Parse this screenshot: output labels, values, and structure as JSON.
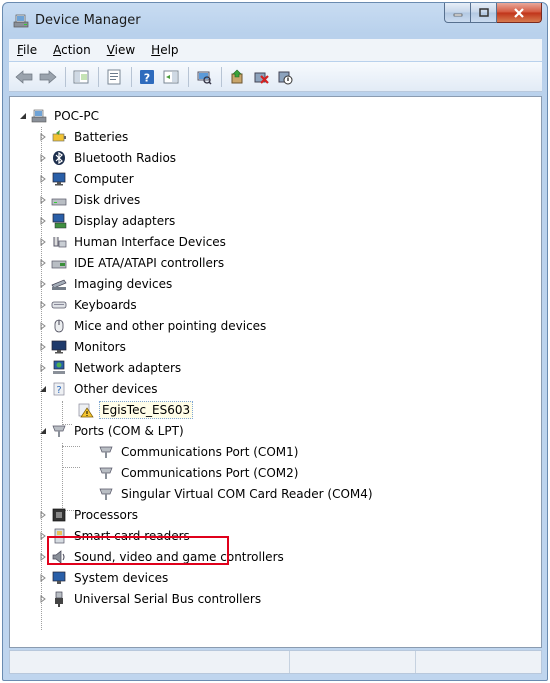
{
  "window": {
    "title": "Device Manager"
  },
  "menu": {
    "file": "F",
    "file_rest": "ile",
    "action": "A",
    "action_rest": "ction",
    "view": "V",
    "view_rest": "iew",
    "help": "H",
    "help_rest": "elp"
  },
  "toolbar": {
    "icons": [
      "back-arrow-icon",
      "forward-arrow-icon",
      "properties-icon",
      "show-hide-console-tree-icon",
      "help-icon",
      "action-pane-icon",
      "scan-hardware-icon",
      "update-driver-icon",
      "uninstall-icon",
      "disable-icon"
    ]
  },
  "tree": {
    "root": "POC-PC",
    "batteries": "Batteries",
    "bluetooth": "Bluetooth Radios",
    "computer": "Computer",
    "disk": "Disk drives",
    "display": "Display adapters",
    "hid": "Human Interface Devices",
    "ide": "IDE ATA/ATAPI controllers",
    "imaging": "Imaging devices",
    "keyboards": "Keyboards",
    "mice": "Mice and other pointing devices",
    "monitors": "Monitors",
    "network": "Network adapters",
    "other": "Other devices",
    "egistec": "EgisTec_ES603",
    "ports": "Ports (COM & LPT)",
    "com1": "Communications Port (COM1)",
    "com2": "Communications Port (COM2)",
    "com4": "Singular Virtual COM Card Reader (COM4)",
    "processors": "Processors",
    "smartcard": "Smart card readers",
    "sound": "Sound, video and game controllers",
    "system": "System devices",
    "usb": "Universal Serial Bus controllers"
  },
  "colors": {
    "highlight": "#e0001b",
    "titlebar": "#c8dcf2",
    "selection_border": "#7ea6d9"
  }
}
